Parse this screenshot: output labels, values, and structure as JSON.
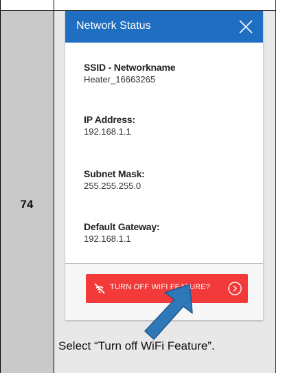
{
  "step": {
    "number": "74"
  },
  "screen": {
    "title": "Network Status",
    "fields": [
      {
        "label": "SSID - Networkname",
        "value": "Heater_16663265"
      },
      {
        "label": "IP Address:",
        "value": "192.168.1.1"
      },
      {
        "label": "Subnet Mask:",
        "value": "255.255.255.0"
      },
      {
        "label": "Default Gateway:",
        "value": "192.168.1.1"
      }
    ],
    "button": {
      "label": "TURN OFF WIFI FEATURE?"
    }
  },
  "instruction": "Select “Turn off WiFi Feature”.",
  "icons": {
    "close": "close-icon",
    "wifi_off": "wifi-off-icon",
    "button_arrow": "chevron-right-circle-icon",
    "pointer": "pointer-arrow"
  },
  "colors": {
    "header": "#1f6ec1",
    "button": "#f23a3a",
    "step_column": "#c9c9c9",
    "pointer_arrow": "#2e78b7"
  }
}
